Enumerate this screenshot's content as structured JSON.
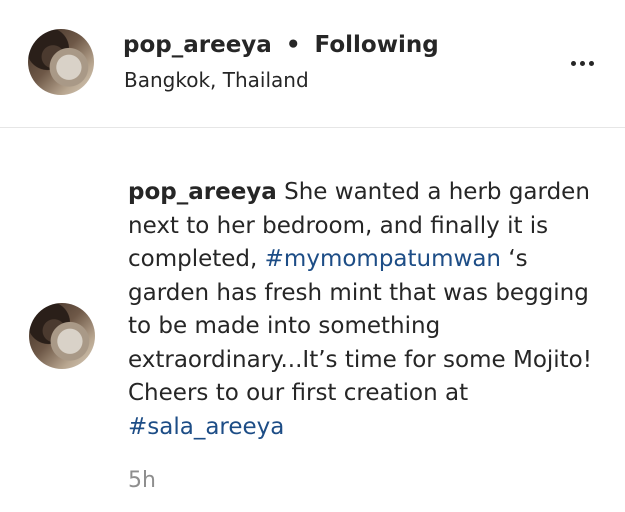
{
  "post_header": {
    "username": "pop_areeya",
    "separator": "•",
    "follow_status": "Following",
    "location": "Bangkok, Thailand"
  },
  "caption": {
    "username": "pop_areeya",
    "text_1": " She wanted a herb garden next to her bedroom, and finally it is completed, ",
    "hashtag_1": "#mymompatumwan",
    "text_2": " ‘s garden has fresh mint that was begging to be made into something extraordinary...It’s time for some Mojito! Cheers to our first creation at ",
    "hashtag_2": "#sala_areeya"
  },
  "timestamp": "5h",
  "icons": {
    "more": "more-options-icon"
  }
}
